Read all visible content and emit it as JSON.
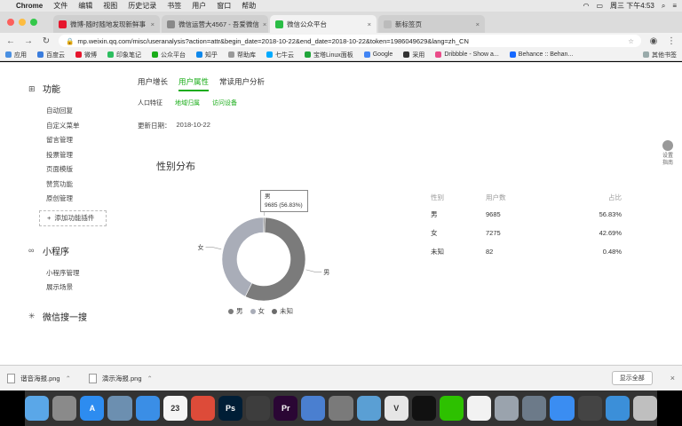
{
  "menubar": {
    "apple": "",
    "app": "Chrome",
    "items": [
      "文件",
      "编辑",
      "视图",
      "历史记录",
      "书签",
      "用户",
      "窗口",
      "帮助"
    ],
    "clock": "周三 下午4:53"
  },
  "browser": {
    "tabs": [
      {
        "title": "微博-随时随地发现新鲜事",
        "active": false
      },
      {
        "title": "微信运营大4567 - 吾爱微信",
        "active": false
      },
      {
        "title": "微信公众平台",
        "active": true
      },
      {
        "title": "新标签页",
        "active": false
      }
    ],
    "url": "mp.weixin.qq.com/misc/useranalysis?action=attr&begin_date=2018-10-22&end_date=2018-10-22&token=1986049629&lang=zh_CN",
    "bookmarks": [
      {
        "label": "应用",
        "color": "#4a90e2"
      },
      {
        "label": "百度云",
        "color": "#3b7ddd"
      },
      {
        "label": "微博",
        "color": "#e6162d"
      },
      {
        "label": "印象笔记",
        "color": "#2dbe60"
      },
      {
        "label": "公众平台",
        "color": "#1aad19"
      },
      {
        "label": "知乎",
        "color": "#0f88eb"
      },
      {
        "label": "帮助库",
        "color": "#999999"
      },
      {
        "label": "七牛云",
        "color": "#00aaff"
      },
      {
        "label": "宝塔Linux面板",
        "color": "#20a53a"
      },
      {
        "label": "Google",
        "color": "#4285f4"
      },
      {
        "label": "采用",
        "color": "#333333"
      },
      {
        "label": "Dribbble - Show a...",
        "color": "#ea4c89"
      },
      {
        "label": "Behance :: Behan...",
        "color": "#1769ff"
      }
    ],
    "bookmarks_other": "其他书签"
  },
  "sidebar": {
    "sections": [
      {
        "title": "功能",
        "icon": "grid-icon",
        "items": [
          "自动回复",
          "自定义菜单",
          "留言管理",
          "投票管理",
          "页面模版",
          "赞赏功能",
          "原创管理"
        ],
        "add": "添加功能插件"
      },
      {
        "title": "小程序",
        "icon": "link-icon",
        "items": [
          "小程序管理",
          "展示场景"
        ]
      },
      {
        "title": "微信搜一搜",
        "icon": "star-icon",
        "items": []
      }
    ]
  },
  "main": {
    "tabs": [
      {
        "label": "用户增长",
        "active": false
      },
      {
        "label": "用户属性",
        "active": true
      },
      {
        "label": "常读用户分析",
        "active": false
      }
    ],
    "subtabs": [
      {
        "label": "人口特征",
        "active": true
      },
      {
        "label": "地域归属",
        "active": false
      },
      {
        "label": "访问设备",
        "active": false
      }
    ],
    "update_label": "更新日期：",
    "update_date": "2018-10-22",
    "section_title": "性别分布"
  },
  "tooltip": {
    "line1": "男",
    "line2": "9685 (56.83%)"
  },
  "chart_data": {
    "type": "pie",
    "donut": true,
    "categories": [
      "男",
      "女",
      "未知"
    ],
    "values": [
      9685,
      7275,
      82
    ],
    "percent": [
      "56.83%",
      "42.69%",
      "0.48%"
    ],
    "colors": [
      "#7b7b7b",
      "#a9adb8",
      "#6b6b6b"
    ],
    "slice_labels": [
      "男",
      "女",
      "未知"
    ],
    "legend": [
      "男",
      "女",
      "未知"
    ],
    "legend_position": "bottom"
  },
  "table": {
    "headers": [
      "性别",
      "用户数",
      "占比"
    ],
    "rows": [
      [
        "男",
        "9685",
        "56.83%"
      ],
      [
        "女",
        "7275",
        "42.69%"
      ],
      [
        "未知",
        "82",
        "0.48%"
      ]
    ]
  },
  "float": {
    "line1": "设置",
    "line2": "指南"
  },
  "downloads": {
    "items": [
      "谐音海报.png",
      "演示海报.png"
    ],
    "show_all": "显示全部"
  },
  "dock": {
    "apps": [
      {
        "name": "finder",
        "label": "",
        "color": "#5aa7e8"
      },
      {
        "name": "launchpad",
        "label": "",
        "color": "#8a8a8a"
      },
      {
        "name": "app-store",
        "label": "A",
        "color": "#2d8cf0"
      },
      {
        "name": "preview",
        "label": "",
        "color": "#6c8fb0"
      },
      {
        "name": "safari",
        "label": "",
        "color": "#3a8ee6"
      },
      {
        "name": "calendar",
        "label": "23",
        "color": "#f5f5f5"
      },
      {
        "name": "app-6",
        "label": "",
        "color": "#dd4b39"
      },
      {
        "name": "photoshop",
        "label": "Ps",
        "color": "#001e36"
      },
      {
        "name": "dvd",
        "label": "",
        "color": "#3d3d3d"
      },
      {
        "name": "premiere",
        "label": "Pr",
        "color": "#2a0634"
      },
      {
        "name": "keynote",
        "label": "",
        "color": "#4a7fd0"
      },
      {
        "name": "app-11",
        "label": "",
        "color": "#7a7a7a"
      },
      {
        "name": "app-12",
        "label": "",
        "color": "#5a9fd4"
      },
      {
        "name": "vectorize",
        "label": "V",
        "color": "#e6e6e6"
      },
      {
        "name": "qq",
        "label": "",
        "color": "#111111"
      },
      {
        "name": "wechat",
        "label": "",
        "color": "#2dc100"
      },
      {
        "name": "notes",
        "label": "",
        "color": "#f2f2f2"
      },
      {
        "name": "app-17",
        "label": "",
        "color": "#9aa3ad"
      },
      {
        "name": "app-18",
        "label": "",
        "color": "#6c7a89"
      },
      {
        "name": "baidu-netdisk",
        "label": "",
        "color": "#3a8df2"
      },
      {
        "name": "app-20",
        "label": "",
        "color": "#444444"
      },
      {
        "name": "downloads",
        "label": "",
        "color": "#3b8fd9"
      },
      {
        "name": "trash",
        "label": "",
        "color": "#bfbfbf"
      }
    ]
  }
}
